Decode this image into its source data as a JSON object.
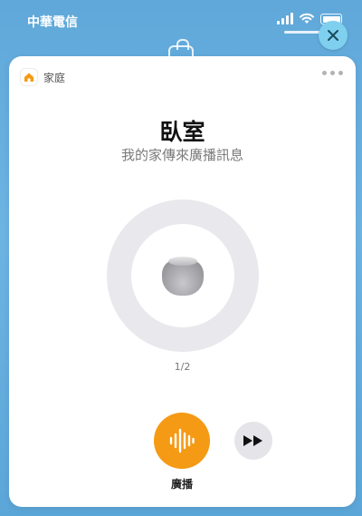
{
  "status_bar": {
    "carrier": "中華電信",
    "icons": [
      "signal-icon",
      "wifi-icon",
      "battery-icon"
    ]
  },
  "close_button": {
    "icon": "close-icon",
    "color": "#7fd0ee"
  },
  "card": {
    "home_label": "家庭",
    "home_icon": "home-icon",
    "more_icon": "more-icon",
    "room_title": "臥室",
    "subtitle": "我的家傳來廣播訊息",
    "device_icon": "homepod-icon",
    "page_indicator": "1/2",
    "broadcast_label": "廣播",
    "broadcast_icon": "waveform-icon",
    "skip_icon": "fast-forward-icon",
    "accent_color": "#f59a14"
  }
}
